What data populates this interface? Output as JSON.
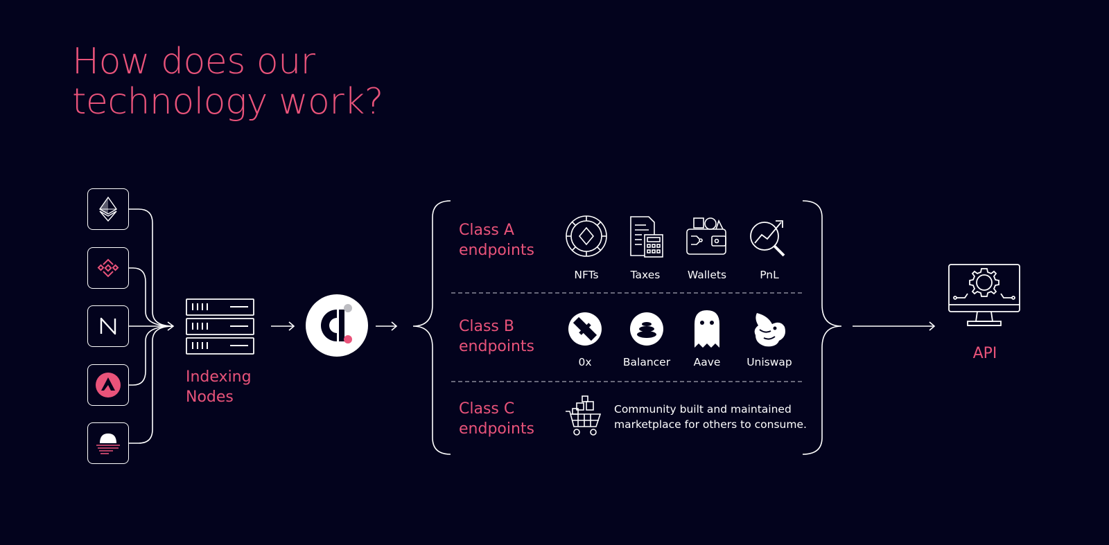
{
  "title": {
    "line1": "How does our",
    "line2": "technology work?"
  },
  "chains": [
    {
      "name": "ethereum",
      "icon": "ethereum-icon"
    },
    {
      "name": "binance",
      "icon": "binance-icon"
    },
    {
      "name": "near",
      "icon": "near-icon"
    },
    {
      "name": "avalanche",
      "icon": "avalanche-icon"
    },
    {
      "name": "other-chain",
      "icon": "striped-dome-icon"
    }
  ],
  "indexing": {
    "line1": "Indexing",
    "line2": "Nodes",
    "icon": "server-rack-icon"
  },
  "core": {
    "icon": "covalent-logo-icon"
  },
  "classes": {
    "a": {
      "line1": "Class A",
      "line2": "endpoints",
      "items": [
        {
          "label": "NFTs",
          "icon": "nft-icon"
        },
        {
          "label": "Taxes",
          "icon": "taxes-icon"
        },
        {
          "label": "Wallets",
          "icon": "wallet-icon"
        },
        {
          "label": "PnL",
          "icon": "pnl-icon"
        }
      ]
    },
    "b": {
      "line1": "Class B",
      "line2": "endpoints",
      "items": [
        {
          "label": "0x",
          "icon": "0x-icon"
        },
        {
          "label": "Balancer",
          "icon": "balancer-icon"
        },
        {
          "label": "Aave",
          "icon": "aave-ghost-icon"
        },
        {
          "label": "Uniswap",
          "icon": "uniswap-unicorn-icon"
        }
      ]
    },
    "c": {
      "line1": "Class C",
      "line2": "endpoints",
      "desc1": "Community built and maintained",
      "desc2": "marketplace for others to consume.",
      "icon": "shopping-cart-icon"
    }
  },
  "api": {
    "label": "API",
    "icon": "monitor-gear-icon"
  },
  "colors": {
    "background": "#03031d",
    "accent": "#e9537a",
    "line": "#ffffff",
    "divider": "#8a8a9a"
  }
}
